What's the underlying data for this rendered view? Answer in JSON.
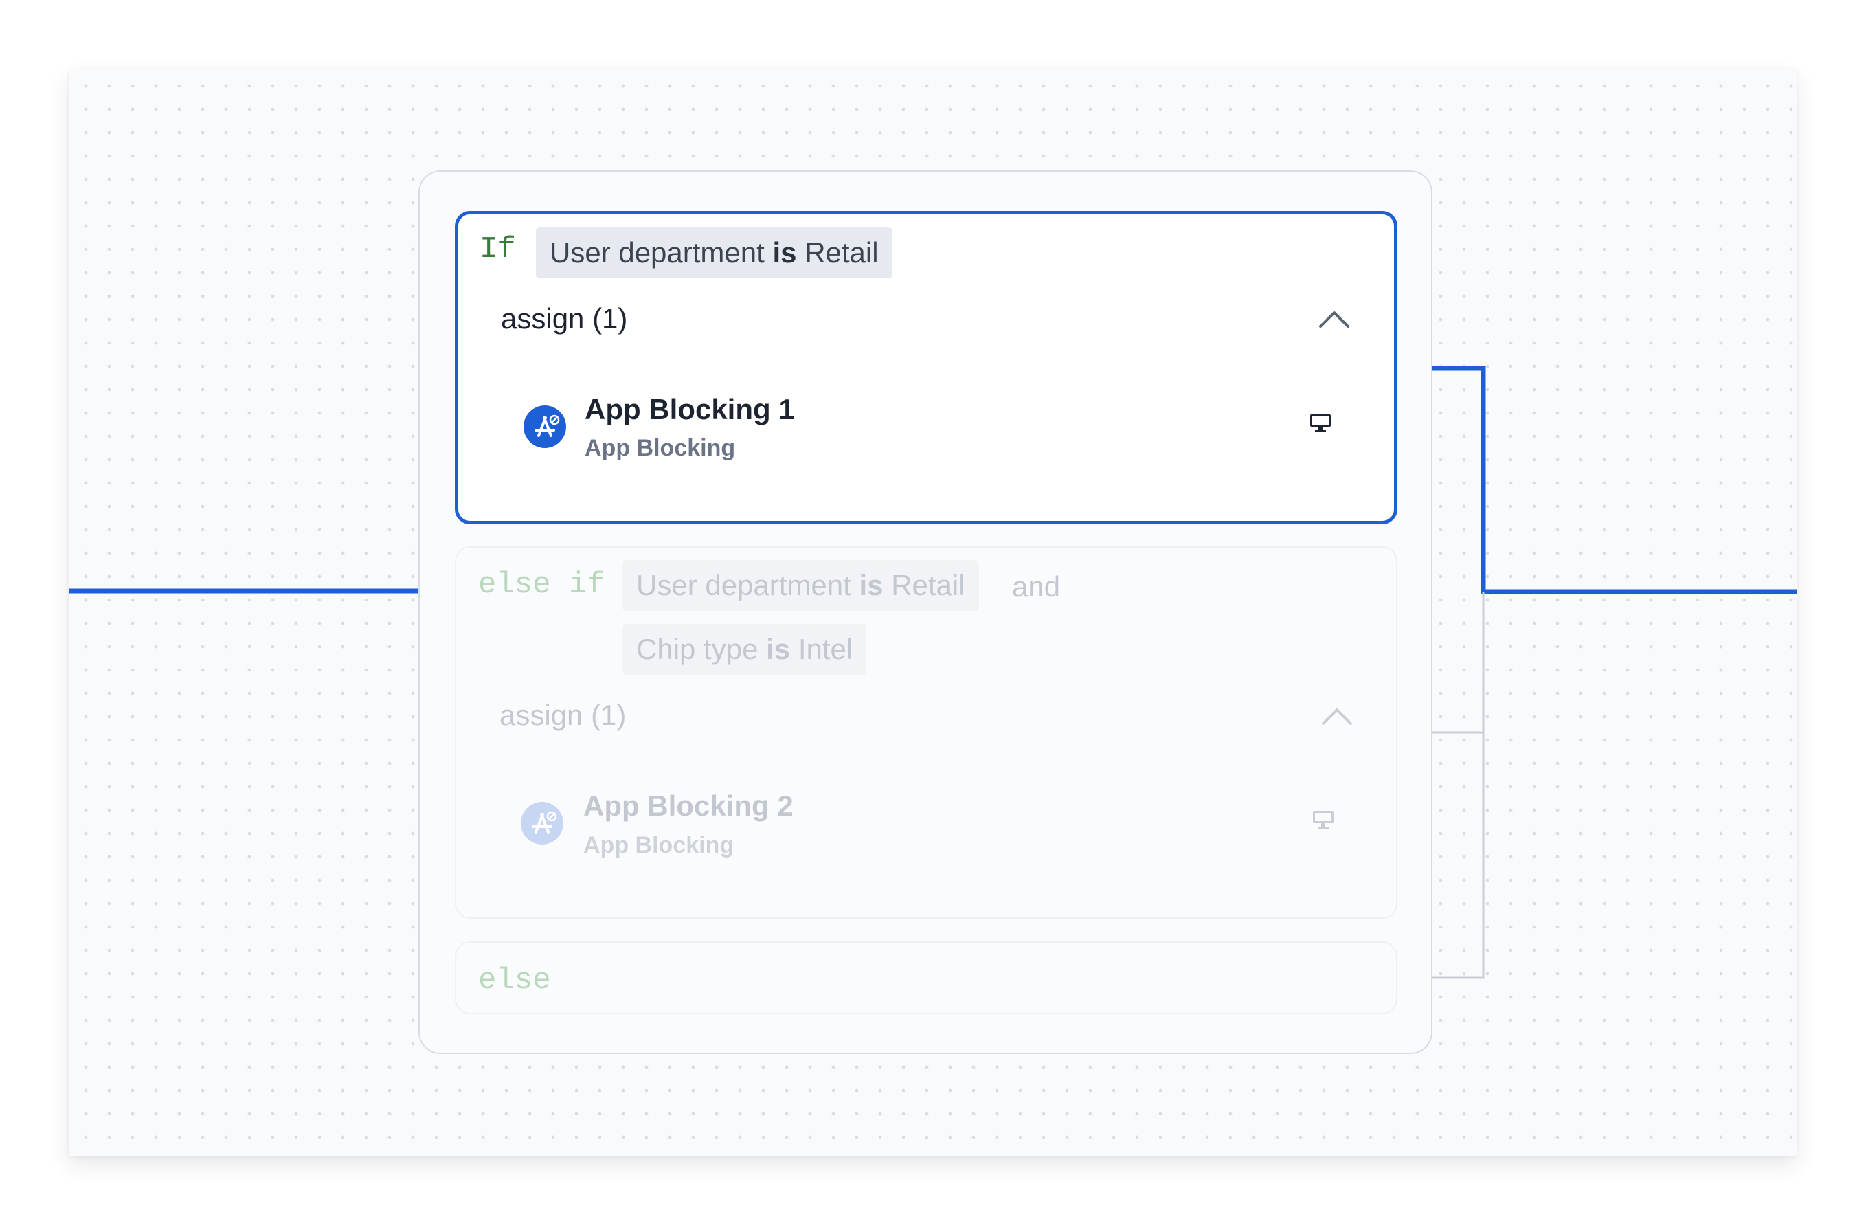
{
  "colors": {
    "accent": "#1f5fd6",
    "keyword_green": "#3a7a3a",
    "keyword_green_faded": "#b9d7bc",
    "chip_bg": "#e6eaf0",
    "chip_bg_faded": "#f1f3f6",
    "text_faded": "#c3c8d0"
  },
  "branches": {
    "if": {
      "keyword": "If",
      "condition": {
        "field": "User department",
        "operator": "is",
        "value": "Retail"
      },
      "assign_label": "assign (1)",
      "assignment": {
        "title": "App Blocking 1",
        "subtitle": "App Blocking",
        "icon": "app-store-icon",
        "platform_icon": "desktop-icon"
      }
    },
    "else_if": {
      "keyword": "else if",
      "condition1": {
        "field": "User department",
        "operator": "is",
        "value": "Retail"
      },
      "connector": "and",
      "condition2": {
        "field": "Chip type",
        "operator": "is",
        "value": "Intel"
      },
      "assign_label": "assign (1)",
      "assignment": {
        "title": "App Blocking 2",
        "subtitle": "App Blocking",
        "icon": "app-store-icon",
        "platform_icon": "desktop-icon"
      }
    },
    "else": {
      "keyword": "else"
    }
  }
}
